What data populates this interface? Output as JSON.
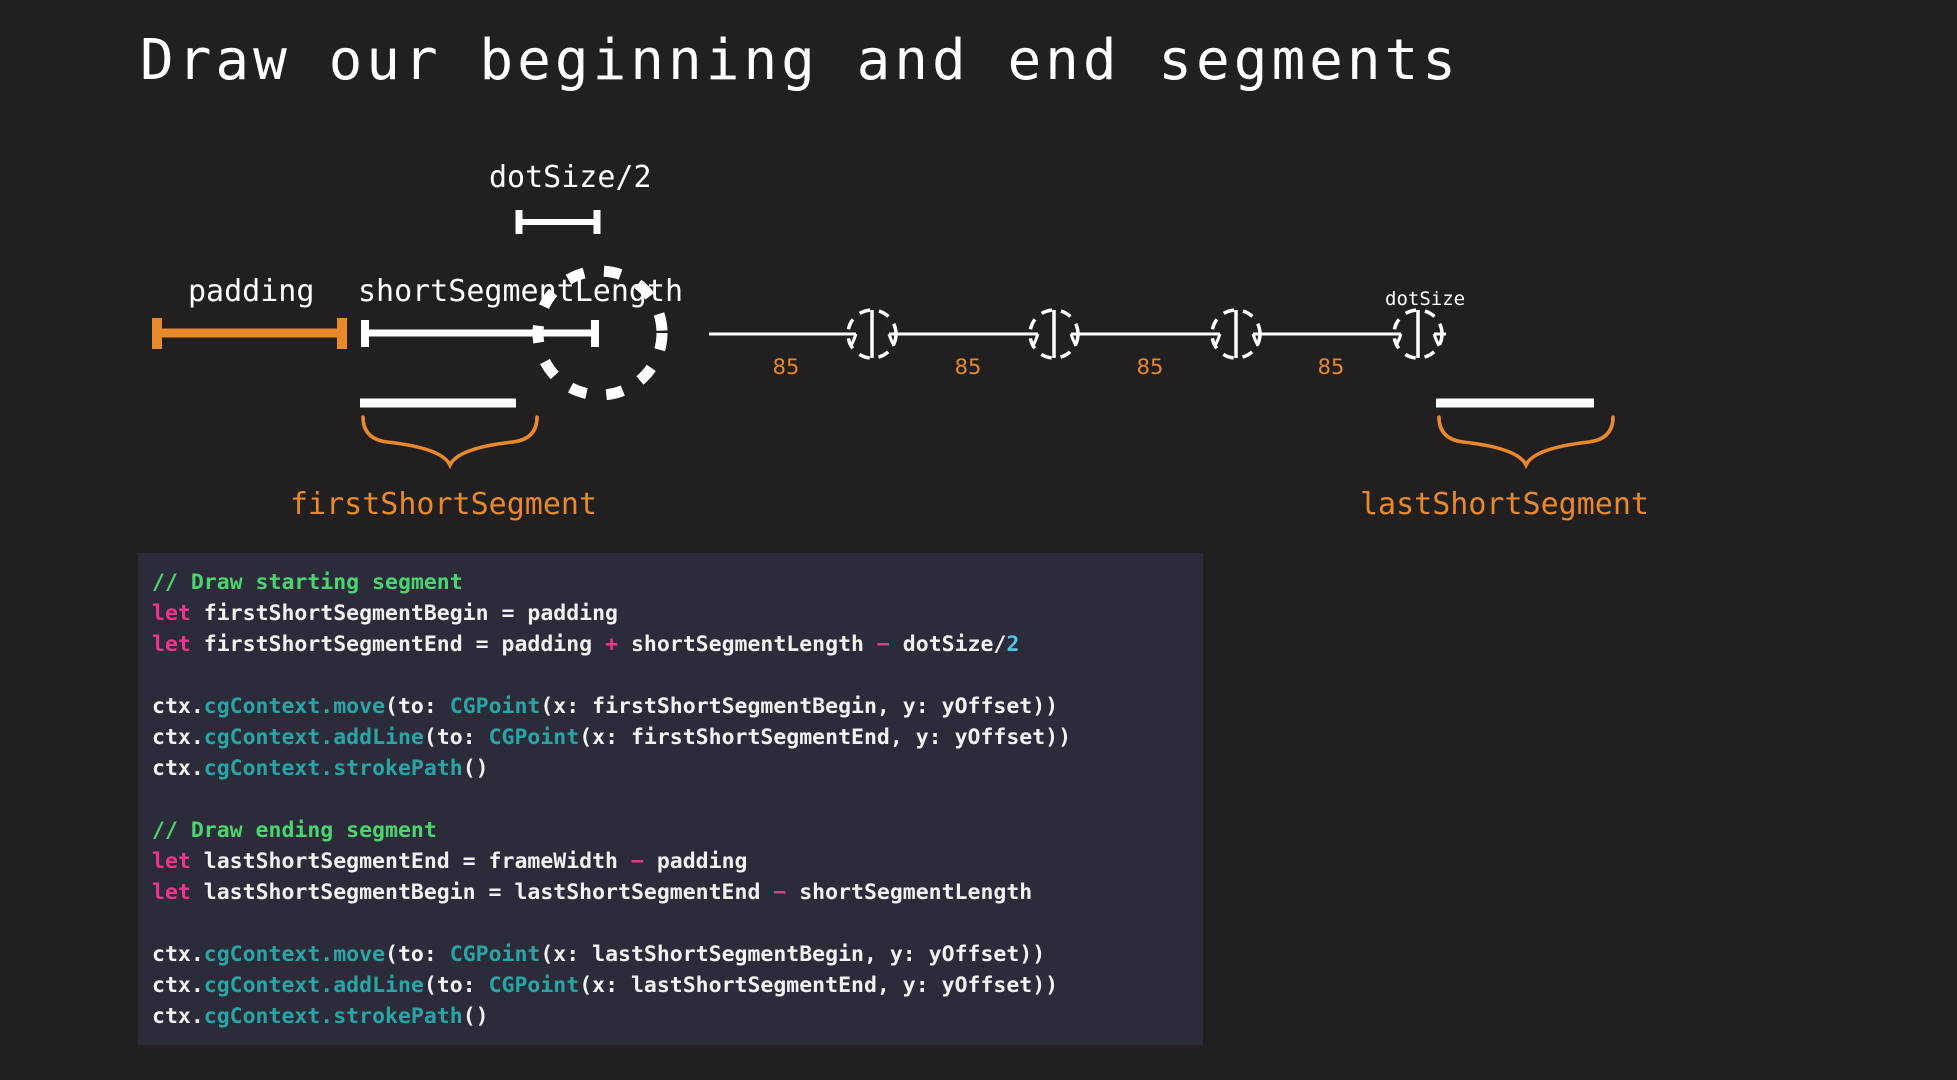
{
  "page": {
    "background": "#211f1f",
    "title": "Draw our beginning and end segments"
  },
  "diagram": {
    "labels": {
      "dot_size_half": "dotSize/2",
      "padding": "padding",
      "short_segment_length": "shortSegmentLength",
      "dot_size": "dotSize",
      "first_short_segment": "firstShortSegment",
      "last_short_segment": "lastShortSegment"
    },
    "colors": {
      "accent_orange": "#e8892b",
      "stroke_white": "#ffffff",
      "code_bg": "#2b2b3a"
    },
    "gap_values": [
      "85",
      "85",
      "85",
      "85"
    ],
    "dot_count": 4
  },
  "code": {
    "lines": [
      {
        "id": "l1",
        "type": "comment",
        "text": "// Draw starting segment"
      },
      {
        "id": "l2",
        "type": "code",
        "text": "let firstShortSegmentBegin = padding"
      },
      {
        "id": "l3",
        "type": "code",
        "text": "let firstShortSegmentEnd = padding + shortSegmentLength - dotSize/2"
      },
      {
        "id": "l4",
        "type": "blank",
        "text": ""
      },
      {
        "id": "l5",
        "type": "code",
        "text": "ctx.cgContext.move(to: CGPoint(x: firstShortSegmentBegin, y: yOffset))"
      },
      {
        "id": "l6",
        "type": "code",
        "text": "ctx.cgContext.addLine(to: CGPoint(x: firstShortSegmentEnd, y: yOffset))"
      },
      {
        "id": "l7",
        "type": "code",
        "text": "ctx.cgContext.strokePath()"
      },
      {
        "id": "l8",
        "type": "blank",
        "text": ""
      },
      {
        "id": "l9",
        "type": "comment",
        "text": "// Draw ending segment"
      },
      {
        "id": "l10",
        "type": "code",
        "text": "let lastShortSegmentEnd = frameWidth - padding"
      },
      {
        "id": "l11",
        "type": "code",
        "text": "let lastShortSegmentBegin = lastShortSegmentEnd - shortSegmentLength"
      },
      {
        "id": "l12",
        "type": "blank",
        "text": ""
      },
      {
        "id": "l13",
        "type": "code",
        "text": "ctx.cgContext.move(to: CGPoint(x: lastShortSegmentBegin, y: yOffset))"
      },
      {
        "id": "l14",
        "type": "code",
        "text": "ctx.cgContext.addLine(to: CGPoint(x: lastShortSegmentEnd, y: yOffset))"
      },
      {
        "id": "l15",
        "type": "code",
        "text": "ctx.cgContext.strokePath()"
      }
    ],
    "tokens": {
      "c1": "// Draw starting segment",
      "c2": "// Draw ending segment",
      "kw_let": "let",
      "t_firstBegin": " firstShortSegmentBegin = padding",
      "t_firstEnd_a": " firstShortSegmentEnd = padding ",
      "t_plus": "+",
      "t_firstEnd_b": " shortSegmentLength ",
      "t_minus": "−",
      "t_firstEnd_c": " dotSize",
      "t_slash": "/",
      "t_two": "2",
      "t_ctx": "ctx.",
      "t_cgContext": "cgContext",
      "t_dot": ".",
      "t_move": "move",
      "t_addLine": "addLine",
      "t_strokePath": "strokePath",
      "t_paren_to": "(to: ",
      "t_CGPoint": "CGPoint",
      "t_args_fsb": "(x: firstShortSegmentBegin, y: yOffset))",
      "t_args_fse": "(x: firstShortSegmentEnd, y: yOffset))",
      "t_args_lsb": "(x: lastShortSegmentBegin, y: yOffset))",
      "t_args_lse": "(x: lastShortSegmentEnd, y: yOffset))",
      "t_empty_parens": "()",
      "t_lastEnd_a": " lastShortSegmentEnd = frameWidth ",
      "t_lastEnd_b": " padding",
      "t_lastBegin_a": " lastShortSegmentBegin = lastShortSegmentEnd ",
      "t_lastBegin_b": " shortSegmentLength"
    }
  }
}
